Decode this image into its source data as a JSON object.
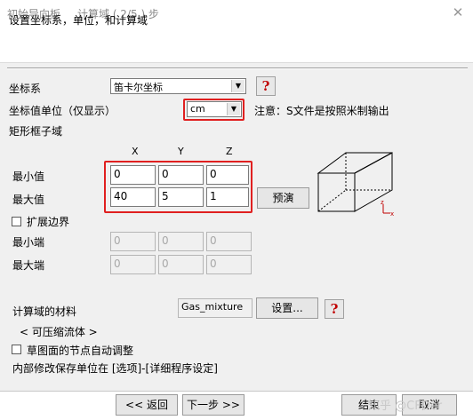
{
  "window": {
    "title": "初始导向板",
    "step": "计算域 ( 2/5 ) 步",
    "close_label": "✕"
  },
  "header": {
    "text": "设置坐标系，单位，和计算域"
  },
  "coordinate_system": {
    "label": "坐标系",
    "value": "笛卡尔坐标",
    "help": "?"
  },
  "units": {
    "label": "坐标值单位（仅显示）",
    "value": "cm",
    "note": "注意：S文件是按照米制输出"
  },
  "domain": {
    "label": "矩形框子域",
    "axes": [
      "X",
      "Y",
      "Z"
    ],
    "min_label": "最小值",
    "max_label": "最大值",
    "min": [
      "0",
      "0",
      "0"
    ],
    "max": [
      "40",
      "5",
      "1"
    ],
    "preview_button": "预演",
    "axis_icon_label_z": "z",
    "axis_icon_label_x": "x"
  },
  "extend": {
    "checkbox_label": "扩展边界",
    "checked": false,
    "min_label": "最小端",
    "max_label": "最大端",
    "min": [
      "0",
      "0",
      "0"
    ],
    "max": [
      "0",
      "0",
      "0"
    ]
  },
  "material": {
    "label": "计算域的材料",
    "value": "Gas_mixture",
    "settings_button": "设置...",
    "help": "?",
    "type_text": "< 可压缩流体 >"
  },
  "auto_adjust": {
    "label": "草图面的节点自动调整",
    "checked": false
  },
  "footer_note": "内部修改保存单位在 [选项]-[详细程序设定]",
  "buttons": {
    "back": "<< 返回",
    "next": "下一步 >>",
    "finish": "结束",
    "cancel": "取消"
  },
  "watermark": "知乎 @CFDer",
  "colors": {
    "highlight": "#e02020",
    "help_icon": "#c00000"
  }
}
